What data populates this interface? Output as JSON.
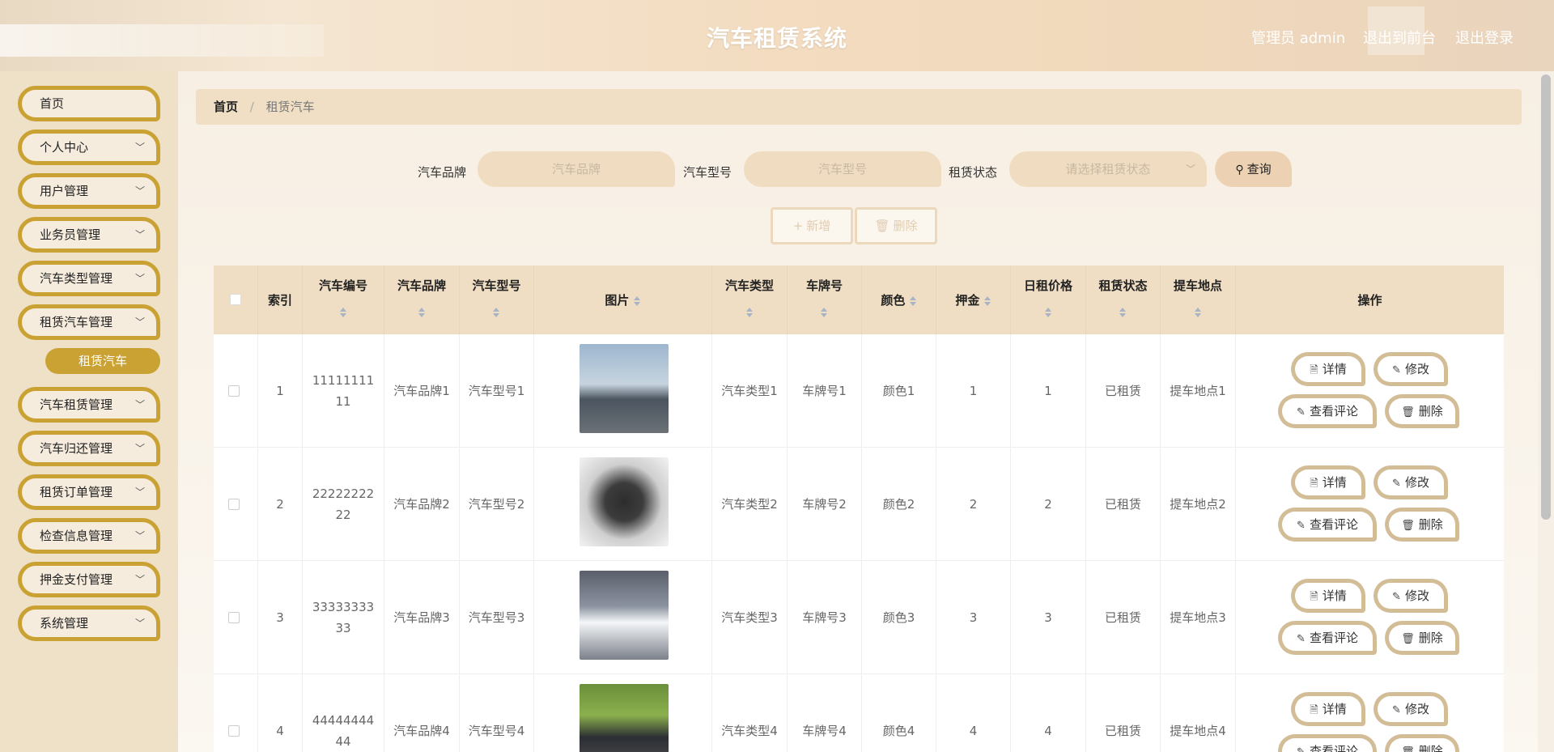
{
  "header": {
    "title": "汽车租赁系统",
    "user": "管理员 admin",
    "to_front": "退出到前台",
    "logout": "退出登录"
  },
  "sidebar": {
    "items": [
      {
        "label": "首页",
        "has_children": false
      },
      {
        "label": "个人中心",
        "has_children": true
      },
      {
        "label": "用户管理",
        "has_children": true
      },
      {
        "label": "业务员管理",
        "has_children": true
      },
      {
        "label": "汽车类型管理",
        "has_children": true
      },
      {
        "label": "租赁汽车管理",
        "has_children": true
      },
      {
        "label": "汽车租赁管理",
        "has_children": true
      },
      {
        "label": "汽车归还管理",
        "has_children": true
      },
      {
        "label": "租赁订单管理",
        "has_children": true
      },
      {
        "label": "检查信息管理",
        "has_children": true
      },
      {
        "label": "押金支付管理",
        "has_children": true
      },
      {
        "label": "系统管理",
        "has_children": true
      }
    ],
    "active_sub": "租赁汽车"
  },
  "breadcrumb": {
    "home": "首页",
    "current": "租赁汽车"
  },
  "search": {
    "brand_label": "汽车品牌",
    "brand_placeholder": "汽车品牌",
    "model_label": "汽车型号",
    "model_placeholder": "汽车型号",
    "status_label": "租赁状态",
    "status_placeholder": "请选择租赁状态",
    "query_button": "查询"
  },
  "actions": {
    "add": "新增",
    "delete": "删除"
  },
  "table": {
    "columns": [
      "索引",
      "汽车编号",
      "汽车品牌",
      "汽车型号",
      "图片",
      "汽车类型",
      "车牌号",
      "颜色",
      "押金",
      "日租价格",
      "租赁状态",
      "提车地点",
      "操作"
    ],
    "op_labels": {
      "detail": "详情",
      "edit": "修改",
      "comments": "查看评论",
      "delete": "删除"
    },
    "rows": [
      {
        "index": "1",
        "code": "1111111111",
        "brand": "汽车品牌1",
        "model": "汽车型号1",
        "image": "sedan-photo",
        "type": "汽车类型1",
        "plate": "车牌号1",
        "color": "颜色1",
        "deposit": "1",
        "daily_price": "1",
        "status": "已租赁",
        "pickup": "提车地点1"
      },
      {
        "index": "2",
        "code": "2222222222",
        "brand": "汽车品牌2",
        "model": "汽车型号2",
        "image": "supercar-photo",
        "type": "汽车类型2",
        "plate": "车牌号2",
        "color": "颜色2",
        "deposit": "2",
        "daily_price": "2",
        "status": "已租赁",
        "pickup": "提车地点2"
      },
      {
        "index": "3",
        "code": "3333333333",
        "brand": "汽车品牌3",
        "model": "汽车型号3",
        "image": "concept-car-photo",
        "type": "汽车类型3",
        "plate": "车牌号3",
        "color": "颜色3",
        "deposit": "3",
        "daily_price": "3",
        "status": "已租赁",
        "pickup": "提车地点3"
      },
      {
        "index": "4",
        "code": "4444444444",
        "brand": "汽车品牌4",
        "model": "汽车型号4",
        "image": "sportscar-photo",
        "type": "汽车类型4",
        "plate": "车牌号4",
        "color": "颜色4",
        "deposit": "4",
        "daily_price": "4",
        "status": "已租赁",
        "pickup": "提车地点4"
      }
    ]
  },
  "colors": {
    "accent": "#c9a233",
    "header_bg": "#f3dcc0",
    "table_header": "#efddc4"
  }
}
